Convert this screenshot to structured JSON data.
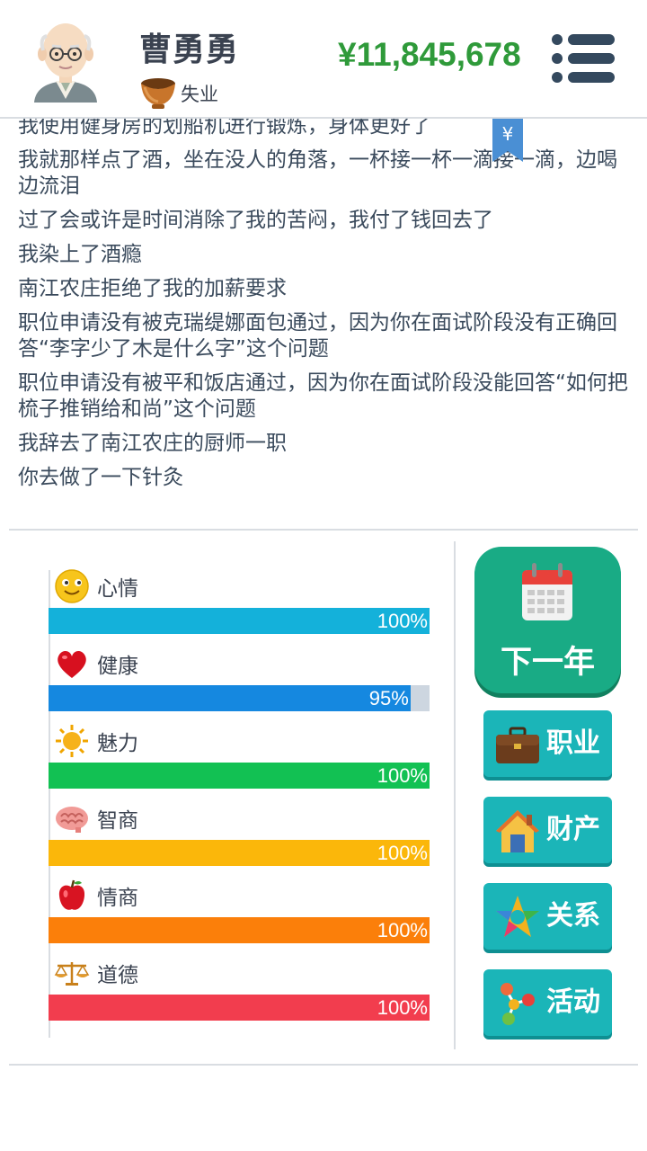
{
  "header": {
    "name": "曹勇勇",
    "job": "失业",
    "money": "¥11,845,678"
  },
  "log": {
    "yen_tag": "¥",
    "lines": [
      "我使用健身房的划船机进行锻炼，身体更好了",
      "我就那样点了酒，坐在没人的角落，一杯接一杯一滴接一滴，边喝边流泪",
      "过了会或许是时间消除了我的苦闷，我付了钱回去了",
      "我染上了酒瘾",
      "南江农庄拒绝了我的加薪要求",
      "职位申请没有被克瑞缇娜面包通过，因为你在面试阶段没有正确回答“李字少了木是什么字”这个问题",
      "职位申请没有被平和饭店通过，因为你在面试阶段没能回答“如何把梳子推销给和尚”这个问题",
      "我辞去了南江农庄的厨师一职",
      "你去做了一下针灸"
    ]
  },
  "stats": [
    {
      "label": "心情",
      "value_text": "100%",
      "value": 1.0,
      "color": "#14b1da",
      "icon": "smiley-icon"
    },
    {
      "label": "健康",
      "value_text": "95%",
      "value": 0.95,
      "color": "#1588e0",
      "icon": "heart-icon"
    },
    {
      "label": "魅力",
      "value_text": "100%",
      "value": 1.0,
      "color": "#12c153",
      "icon": "sun-icon"
    },
    {
      "label": "智商",
      "value_text": "100%",
      "value": 1.0,
      "color": "#fbb70a",
      "icon": "brain-icon"
    },
    {
      "label": "情商",
      "value_text": "100%",
      "value": 1.0,
      "color": "#fb7f0a",
      "icon": "apple-icon"
    },
    {
      "label": "道德",
      "value_text": "100%",
      "value": 1.0,
      "color": "#f23d4e",
      "icon": "scales-icon"
    }
  ],
  "buttons": {
    "next_year": "下一年",
    "career": "职业",
    "assets": "财产",
    "relations": "关系",
    "activities": "活动"
  },
  "colors": {
    "money": "#2f9a3a",
    "next_year_bg": "#19ab85",
    "action_bg": "#1bb5b8"
  }
}
